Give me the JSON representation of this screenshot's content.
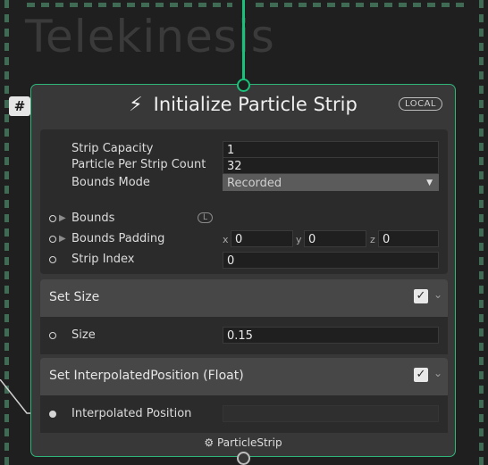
{
  "background_title": "Telekinesis",
  "badge": {
    "hash": "#"
  },
  "node": {
    "title": "Initialize Particle Strip",
    "icon": "lightning-icon",
    "space_badge": "LOCAL",
    "properties": {
      "strip_capacity": {
        "label": "Strip Capacity",
        "value": "1"
      },
      "particle_per_strip": {
        "label": "Particle Per Strip Count",
        "value": "32"
      },
      "bounds_mode": {
        "label": "Bounds Mode",
        "value": "Recorded"
      },
      "bounds": {
        "label": "Bounds",
        "badge": "L"
      },
      "bounds_padding": {
        "label": "Bounds Padding",
        "x_label": "x",
        "x": "0",
        "y_label": "y",
        "y": "0",
        "z_label": "z",
        "z": "0"
      },
      "strip_index": {
        "label": "Strip Index",
        "value": "0"
      }
    },
    "blocks": [
      {
        "title": "Set Size",
        "enabled": true,
        "row_label": "Size",
        "row_value": "0.15"
      },
      {
        "title": "Set InterpolatedPosition (Float)",
        "enabled": true,
        "row_label": "Interpolated Position",
        "row_value": ""
      }
    ],
    "footer": "ParticleStrip",
    "footer_icon": "particle-strip-icon"
  },
  "colors": {
    "accent": "#19c27a",
    "node_bg": "#383838",
    "section_bg": "#2b2b2b",
    "header_bg": "#474747"
  }
}
